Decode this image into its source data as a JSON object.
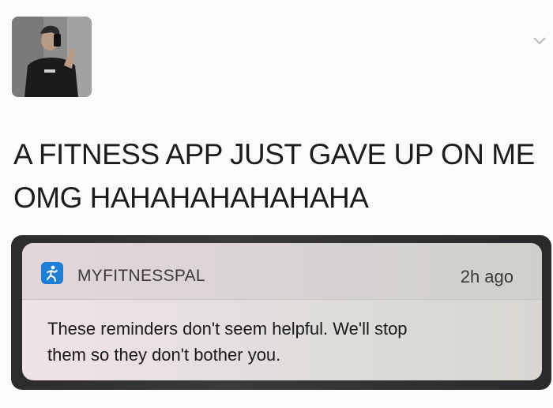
{
  "post": {
    "line1": "A FITNESS APP JUST GAVE UP ON ME",
    "line2": "OMG HAHAHAHAHAHAHA"
  },
  "notification": {
    "app_name": "MYFITNESSPAL",
    "time": "2h ago",
    "message_line1": "These reminders don't seem helpful. We'll stop",
    "message_line2": "them so they don't bother you.",
    "app_icon": "running-figure-icon",
    "app_icon_color": "#1d7fd6"
  },
  "header": {
    "menu_icon": "chevron-down-icon"
  }
}
